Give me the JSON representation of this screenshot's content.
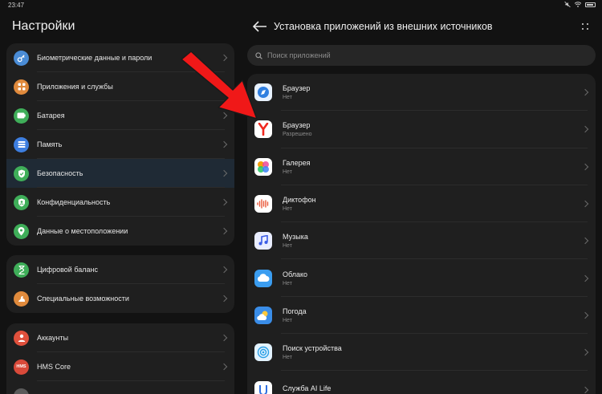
{
  "status_bar": {
    "time": "23:47"
  },
  "settings": {
    "title": "Настройки",
    "groups": [
      [
        {
          "label": "Биометрические данные и пароли",
          "icon": "key-icon",
          "color": "#4a8cd6"
        },
        {
          "label": "Приложения и службы",
          "icon": "apps-icon",
          "color": "#e08a3c"
        },
        {
          "label": "Батарея",
          "icon": "battery-icon",
          "color": "#3fae59"
        },
        {
          "label": "Память",
          "icon": "storage-icon",
          "color": "#3d7ee0"
        },
        {
          "label": "Безопасность",
          "icon": "shield-icon",
          "color": "#3fae59"
        },
        {
          "label": "Конфиденциальность",
          "icon": "privacy-icon",
          "color": "#3fae59"
        },
        {
          "label": "Данные о местоположении",
          "icon": "location-icon",
          "color": "#3fae59"
        }
      ],
      [
        {
          "label": "Цифровой баланс",
          "icon": "hourglass-icon",
          "color": "#3fae59"
        },
        {
          "label": "Специальные возможности",
          "icon": "accessibility-icon",
          "color": "#e08a3c"
        }
      ],
      [
        {
          "label": "Аккаунты",
          "icon": "account-icon",
          "color": "#e0503c"
        },
        {
          "label": "HMS Core",
          "icon": "hms-icon",
          "color": "#d94a3a"
        },
        {
          "label": "",
          "icon": "about-icon",
          "color": "#5a5a5a"
        }
      ]
    ],
    "active": "Безопасность"
  },
  "install_page": {
    "title": "Установка приложений из внешних источников",
    "search_placeholder": "Поиск приложений",
    "apps": [
      {
        "name": "Браузер",
        "status": "Нет",
        "icon": "browser-icon",
        "bg": "#e8f2ff",
        "fg": "#2f7fe0"
      },
      {
        "name": "Браузер",
        "status": "Разрешено",
        "icon": "yandex-browser-icon",
        "bg": "#ffffff",
        "fg": "#f0281e"
      },
      {
        "name": "Галерея",
        "status": "Нет",
        "icon": "gallery-icon",
        "bg": "#ffffff",
        "fg": "#f59e0b"
      },
      {
        "name": "Диктофон",
        "status": "Нет",
        "icon": "recorder-icon",
        "bg": "#ffffff",
        "fg": "#ea5a3c"
      },
      {
        "name": "Музыка",
        "status": "Нет",
        "icon": "music-icon",
        "bg": "#e9edff",
        "fg": "#3b5ce6"
      },
      {
        "name": "Облако",
        "status": "Нет",
        "icon": "cloud-icon",
        "bg": "#3b9df0",
        "fg": "#ffffff"
      },
      {
        "name": "Погода",
        "status": "Нет",
        "icon": "weather-icon",
        "bg": "#3a8de8",
        "fg": "#ffc93c"
      },
      {
        "name": "Поиск устройства",
        "status": "Нет",
        "icon": "find-device-icon",
        "bg": "#e3f3ff",
        "fg": "#2aa0e6"
      },
      {
        "name": "Служба AI Life",
        "status": "",
        "icon": "ai-life-icon",
        "bg": "#ffffff",
        "fg": "#2f6fe0"
      }
    ]
  },
  "annotation": {
    "arrow_color": "#f01818"
  }
}
